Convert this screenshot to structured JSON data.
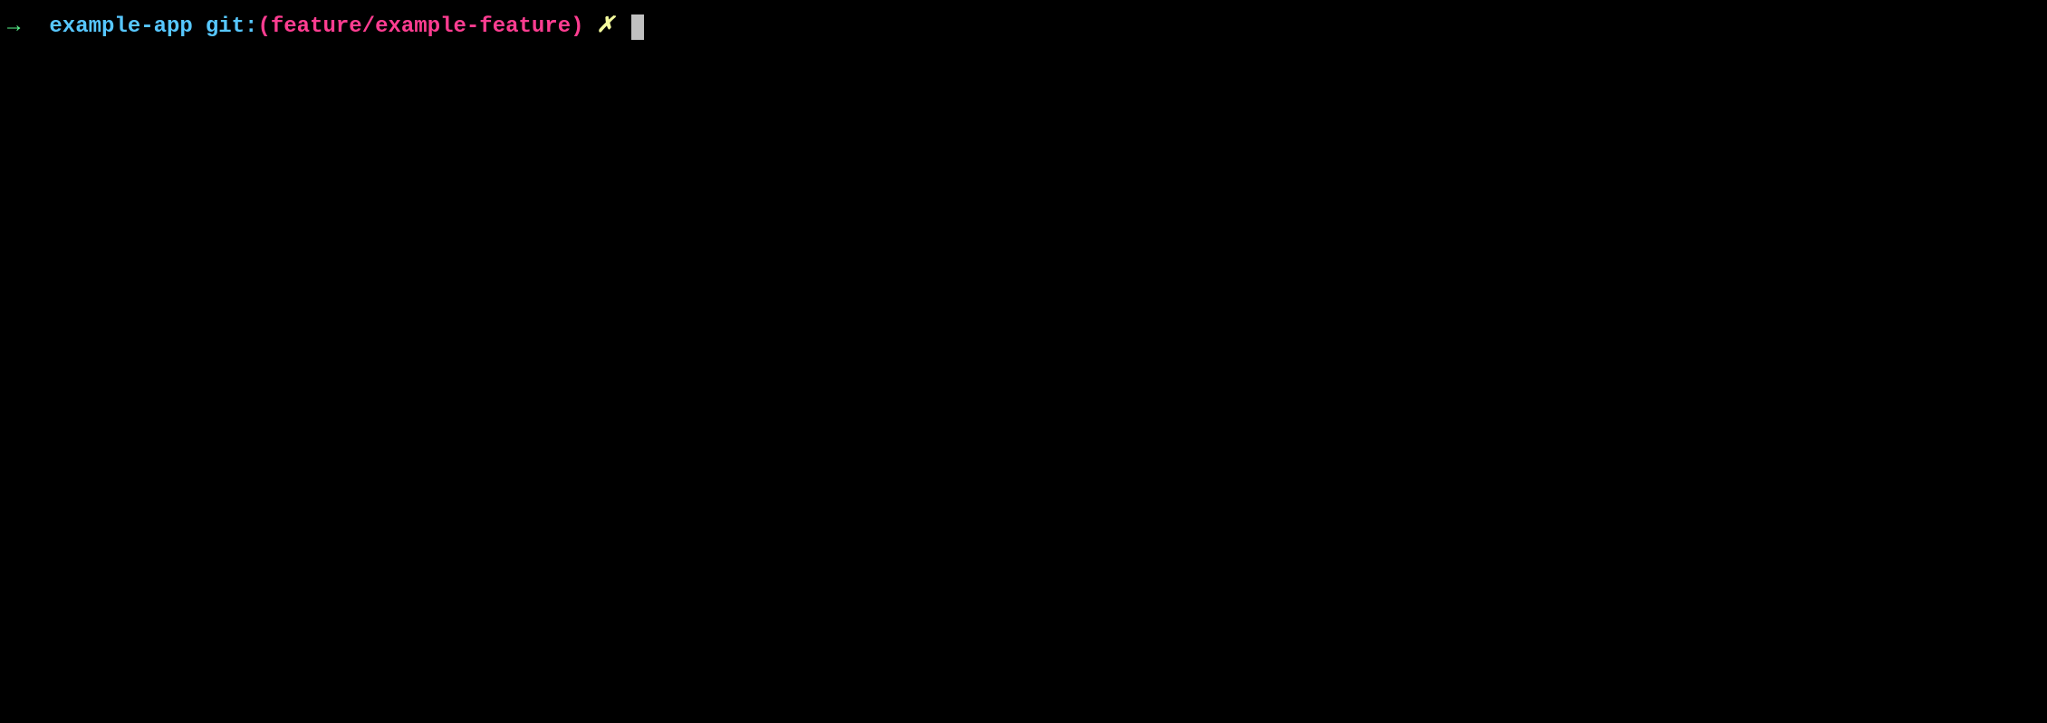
{
  "prompt": {
    "arrow": "→",
    "directory": "example-app",
    "git_label": "git:",
    "paren_open": "(",
    "branch": "feature/example-feature",
    "paren_close": ")",
    "dirty_marker": "✗"
  }
}
